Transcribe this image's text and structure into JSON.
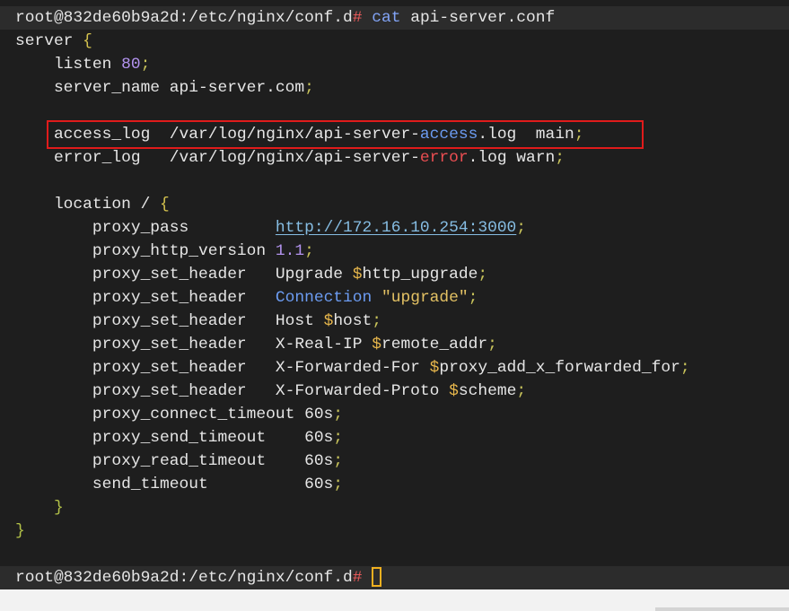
{
  "terminal": {
    "palette": {
      "background": "#1e1e1e",
      "prompt_band": "#2c2c2c",
      "annotation_box": "#e01b1b",
      "cursor": "#f0b020",
      "below_terminal": "#f2f2f2",
      "bottom_bar": "#d4d4d4"
    },
    "lines": [
      {
        "highlighted": true,
        "tokens": [
          {
            "text": "root@832de60b9a2d:/etc/nginx/conf.d",
            "color": "#e6e6e6"
          },
          {
            "text": "# ",
            "color": "#f05c5c"
          },
          {
            "text": "cat",
            "color": "#82a4f6"
          },
          {
            "text": " api-server.conf",
            "color": "#e6e6e6"
          }
        ]
      },
      {
        "tokens": [
          {
            "text": "server ",
            "color": "#e6e6e6"
          },
          {
            "text": "{",
            "color": "#d4c24e"
          }
        ]
      },
      {
        "tokens": [
          {
            "text": "    listen ",
            "color": "#e6e6e6"
          },
          {
            "text": "80",
            "color": "#b393ef"
          },
          {
            "text": ";",
            "color": "#c9c45b"
          }
        ]
      },
      {
        "tokens": [
          {
            "text": "    server_name api-server.com",
            "color": "#e6e6e6"
          },
          {
            "text": ";",
            "color": "#c9c45b"
          }
        ]
      },
      {
        "tokens": []
      },
      {
        "tokens": [
          {
            "text": "    access_log  /var/log/nginx/api-server-",
            "color": "#e6e6e6"
          },
          {
            "text": "access",
            "color": "#6c9cf2"
          },
          {
            "text": ".log  main",
            "color": "#e6e6e6"
          },
          {
            "text": ";",
            "color": "#c9c45b"
          }
        ]
      },
      {
        "tokens": [
          {
            "text": "    error_log   /var/log/nginx/api-server-",
            "color": "#e6e6e6"
          },
          {
            "text": "error",
            "color": "#ec4e52"
          },
          {
            "text": ".log warn",
            "color": "#e6e6e6"
          },
          {
            "text": ";",
            "color": "#c9c45b"
          }
        ]
      },
      {
        "tokens": []
      },
      {
        "tokens": [
          {
            "text": "    location / ",
            "color": "#e6e6e6"
          },
          {
            "text": "{",
            "color": "#d4c24e"
          }
        ]
      },
      {
        "tokens": [
          {
            "text": "        proxy_pass         ",
            "color": "#e6e6e6"
          },
          {
            "text": "http://172.16.10.254:3000",
            "color": "#86bde3",
            "link": true
          },
          {
            "text": ";",
            "color": "#c9c45b"
          }
        ]
      },
      {
        "tokens": [
          {
            "text": "        proxy_http_version ",
            "color": "#e6e6e6"
          },
          {
            "text": "1.1",
            "color": "#b393ef"
          },
          {
            "text": ";",
            "color": "#c9c45b"
          }
        ]
      },
      {
        "tokens": [
          {
            "text": "        proxy_set_header   Upgrade ",
            "color": "#e6e6e6"
          },
          {
            "text": "$",
            "color": "#e9b84c"
          },
          {
            "text": "http_upgrade",
            "color": "#e6e6e6"
          },
          {
            "text": ";",
            "color": "#c9c45b"
          }
        ]
      },
      {
        "tokens": [
          {
            "text": "        proxy_set_header   ",
            "color": "#e6e6e6"
          },
          {
            "text": "Connection",
            "color": "#6c9cf2"
          },
          {
            "text": " \"upgrade\"",
            "color": "#e4c264"
          },
          {
            "text": ";",
            "color": "#c9c45b"
          }
        ]
      },
      {
        "tokens": [
          {
            "text": "        proxy_set_header   Host ",
            "color": "#e6e6e6"
          },
          {
            "text": "$",
            "color": "#e9b84c"
          },
          {
            "text": "host",
            "color": "#e6e6e6"
          },
          {
            "text": ";",
            "color": "#c9c45b"
          }
        ]
      },
      {
        "tokens": [
          {
            "text": "        proxy_set_header   X-Real-IP ",
            "color": "#e6e6e6"
          },
          {
            "text": "$",
            "color": "#e9b84c"
          },
          {
            "text": "remote_addr",
            "color": "#e6e6e6"
          },
          {
            "text": ";",
            "color": "#c9c45b"
          }
        ]
      },
      {
        "tokens": [
          {
            "text": "        proxy_set_header   X-Forwarded-For ",
            "color": "#e6e6e6"
          },
          {
            "text": "$",
            "color": "#e9b84c"
          },
          {
            "text": "proxy_add_x_forwarded_for",
            "color": "#e6e6e6"
          },
          {
            "text": ";",
            "color": "#c9c45b"
          }
        ]
      },
      {
        "tokens": [
          {
            "text": "        proxy_set_header   X-Forwarded-Proto ",
            "color": "#e6e6e6"
          },
          {
            "text": "$",
            "color": "#e9b84c"
          },
          {
            "text": "scheme",
            "color": "#e6e6e6"
          },
          {
            "text": ";",
            "color": "#c9c45b"
          }
        ]
      },
      {
        "tokens": [
          {
            "text": "        proxy_connect_timeout 60s",
            "color": "#e6e6e6"
          },
          {
            "text": ";",
            "color": "#c9c45b"
          }
        ]
      },
      {
        "tokens": [
          {
            "text": "        proxy_send_timeout    60s",
            "color": "#e6e6e6"
          },
          {
            "text": ";",
            "color": "#c9c45b"
          }
        ]
      },
      {
        "tokens": [
          {
            "text": "        proxy_read_timeout    60s",
            "color": "#e6e6e6"
          },
          {
            "text": ";",
            "color": "#c9c45b"
          }
        ]
      },
      {
        "tokens": [
          {
            "text": "        send_timeout          60s",
            "color": "#e6e6e6"
          },
          {
            "text": ";",
            "color": "#c9c45b"
          }
        ]
      },
      {
        "tokens": [
          {
            "text": "    }",
            "color": "#b3c248"
          }
        ]
      },
      {
        "tokens": [
          {
            "text": "}",
            "color": "#b3c248"
          }
        ]
      },
      {
        "tokens": []
      },
      {
        "highlighted": true,
        "cursor": true,
        "tokens": [
          {
            "text": "root@832de60b9a2d:/etc/nginx/conf.d",
            "color": "#e6e6e6"
          },
          {
            "text": "# ",
            "color": "#f05c5c"
          }
        ]
      }
    ]
  }
}
